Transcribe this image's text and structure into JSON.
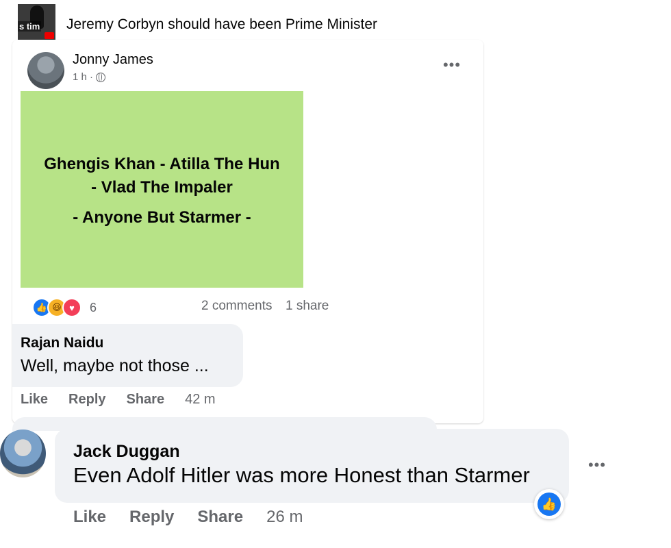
{
  "group": {
    "title": "Jeremy Corbyn should have been Prime Minister",
    "thumb_caption": "s tim"
  },
  "post": {
    "author": "Jonny James",
    "time": "1 h ·",
    "image_lines": [
      "Ghengis Khan - Atilla The Hun",
      "- Vlad The Impaler",
      "- Anyone But Starmer -"
    ],
    "image_bg": "#b7e387",
    "reaction_count": "6",
    "comments": "2 comments",
    "shares": "1 share"
  },
  "comments": [
    {
      "author": "Rajan Naidu",
      "text": "Well, maybe not those ...",
      "actions": {
        "like": "Like",
        "reply": "Reply",
        "share": "Share"
      },
      "time": "42 m"
    },
    {
      "author": "Jack Duggan",
      "text": "Even Adolf Hitler was more Honest than Starmer",
      "actions": {
        "like": "Like",
        "reply": "Reply",
        "share": "Share"
      },
      "time": "26 m",
      "reaction": "like-icon"
    }
  ],
  "icons": {
    "menu": "•••",
    "like": "👍",
    "haha": "😆",
    "love": "♥"
  },
  "colors": {
    "accent": "#1877f2",
    "secondary_text": "#65676b",
    "bubble": "#f0f2f5"
  }
}
